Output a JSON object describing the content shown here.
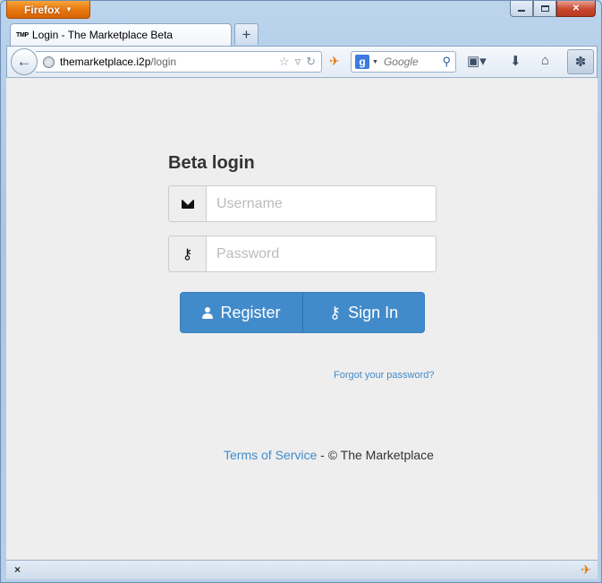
{
  "browser": {
    "menu_label": "Firefox",
    "tab_favicon": "TMP",
    "tab_title": "Login - The Marketplace Beta",
    "new_tab_label": "+",
    "url_host": "themarketplace.i2p",
    "url_path": "/login",
    "search_engine_glyph": "g",
    "search_placeholder": "Google"
  },
  "page": {
    "title": "Beta login",
    "username_placeholder": "Username",
    "password_placeholder": "Password",
    "register_label": "Register",
    "signin_label": "Sign In",
    "forgot_label": "Forgot your password?",
    "footer_link": "Terms of Service",
    "footer_text": " - © The Marketplace"
  },
  "icons": [
    "firefox-menu-icon",
    "back-arrow-icon",
    "globe-icon",
    "star-icon",
    "reload-icon",
    "search-icon",
    "bookmarks-icon",
    "download-icon",
    "home-icon",
    "addon-icon",
    "envelope-icon",
    "key-icon",
    "user-icon"
  ],
  "colors": {
    "primary": "#428bca",
    "page_background": "#eeeeee",
    "firefox_orange": "#e9770e"
  }
}
